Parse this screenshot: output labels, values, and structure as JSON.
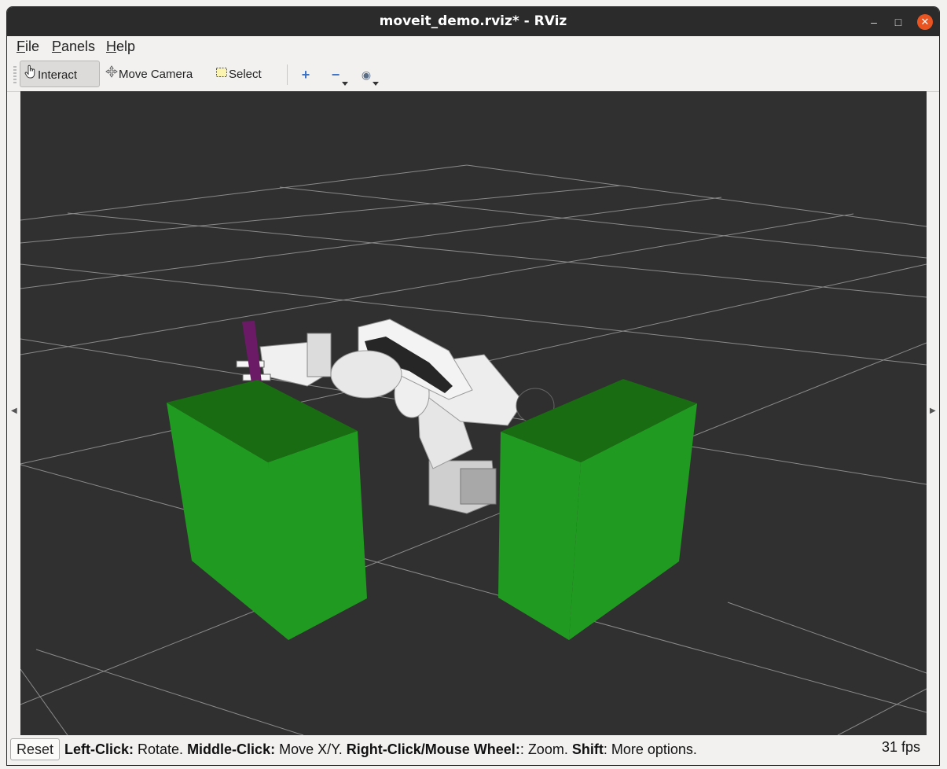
{
  "window": {
    "title": "moveit_demo.rviz* - RViz"
  },
  "window_controls": {
    "minimize": "–",
    "maximize": "□",
    "close": "✕"
  },
  "menu": [
    {
      "key": "F",
      "rest": "ile"
    },
    {
      "key": "P",
      "rest": "anels"
    },
    {
      "key": "H",
      "rest": "elp"
    }
  ],
  "toolbar": {
    "interact": {
      "label": "Interact",
      "icon": "hand-pointer-icon"
    },
    "move_camera": {
      "label": "Move Camera",
      "icon": "move-arrows-icon"
    },
    "select": {
      "label": "Select",
      "icon": "select-rect-icon"
    },
    "add_tool": {
      "icon": "plus-icon",
      "glyph": "+"
    },
    "remove_tool": {
      "icon": "minus-icon",
      "glyph": "−"
    },
    "view_tool": {
      "icon": "eye-icon",
      "glyph": "◉"
    }
  },
  "scene": {
    "background_color": "#303030",
    "grid_color": "#8a8a8a",
    "box_color": "#219a21",
    "box_top_color": "#1a6c12",
    "object_color": "#6b1b66"
  },
  "status": {
    "reset_label": "Reset",
    "hint": [
      {
        "bold": "Left-Click:",
        "text": " Rotate. "
      },
      {
        "bold": "Middle-Click:",
        "text": " Move X/Y. "
      },
      {
        "bold": "Right-Click/Mouse Wheel:",
        "text": ": Zoom. "
      },
      {
        "bold": "Shift",
        "text": ": More options."
      }
    ],
    "fps": "31 fps"
  }
}
